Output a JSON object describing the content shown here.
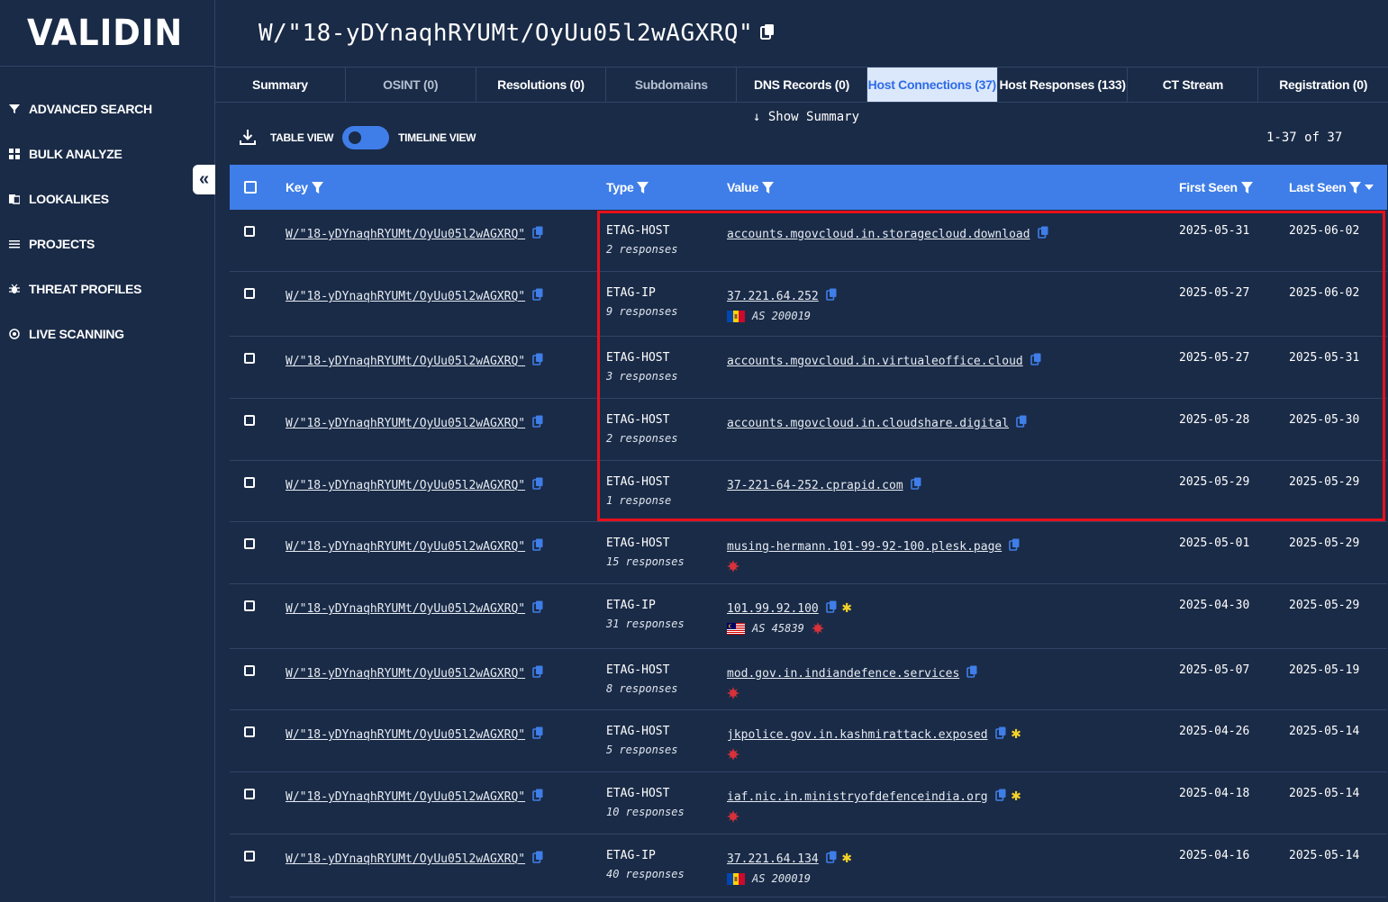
{
  "app": {
    "logo": "VALIDIN"
  },
  "sidebar": {
    "items": [
      {
        "label": "ADVANCED SEARCH",
        "icon": "filter-icon"
      },
      {
        "label": "BULK ANALYZE",
        "icon": "grid-icon"
      },
      {
        "label": "LOOKALIKES",
        "icon": "lookalike-icon"
      },
      {
        "label": "PROJECTS",
        "icon": "list-icon"
      },
      {
        "label": "THREAT PROFILES",
        "icon": "bug-icon"
      },
      {
        "label": "LIVE SCANNING",
        "icon": "target-icon"
      }
    ],
    "collapse_glyph": "«"
  },
  "header": {
    "title": "W/\"18-yDYnaqhRYUMt/OyUu05l2wAGXRQ\""
  },
  "tabs": [
    {
      "label": "Summary",
      "state": "normal"
    },
    {
      "label": "OSINT (0)",
      "state": "disabled"
    },
    {
      "label": "Resolutions (0)",
      "state": "normal"
    },
    {
      "label": "Subdomains",
      "state": "disabled"
    },
    {
      "label": "DNS Records (0)",
      "state": "normal"
    },
    {
      "label": "Host Connections (37)",
      "state": "active"
    },
    {
      "label": "Host Responses (133)",
      "state": "normal"
    },
    {
      "label": "CT Stream",
      "state": "normal"
    },
    {
      "label": "Registration (0)",
      "state": "normal"
    }
  ],
  "toolbar": {
    "show_summary": "Show Summary",
    "table_view": "TABLE VIEW",
    "timeline_view": "TIMELINE VIEW",
    "pagination": "1-37 of 37"
  },
  "table": {
    "columns": {
      "key": "Key",
      "type": "Type",
      "value": "Value",
      "first_seen": "First Seen",
      "last_seen": "Last Seen"
    },
    "rows": [
      {
        "key": "W/\"18-yDYnaqhRYUMt/OyUu05l2wAGXRQ\"",
        "type": "ETAG-HOST",
        "responses": "2 responses",
        "value": "accounts.mgovcloud.in.storagecloud.download",
        "first": "2025-05-31",
        "last": "2025-06-02"
      },
      {
        "key": "W/\"18-yDYnaqhRYUMt/OyUu05l2wAGXRQ\"",
        "type": "ETAG-IP",
        "responses": "9 responses",
        "value": "37.221.64.252",
        "asn": "AS 200019",
        "flag": "md",
        "first": "2025-05-27",
        "last": "2025-06-02"
      },
      {
        "key": "W/\"18-yDYnaqhRYUMt/OyUu05l2wAGXRQ\"",
        "type": "ETAG-HOST",
        "responses": "3 responses",
        "value": "accounts.mgovcloud.in.virtualeoffice.cloud",
        "first": "2025-05-27",
        "last": "2025-05-31"
      },
      {
        "key": "W/\"18-yDYnaqhRYUMt/OyUu05l2wAGXRQ\"",
        "type": "ETAG-HOST",
        "responses": "2 responses",
        "value": "accounts.mgovcloud.in.cloudshare.digital",
        "first": "2025-05-28",
        "last": "2025-05-30"
      },
      {
        "key": "W/\"18-yDYnaqhRYUMt/OyUu05l2wAGXRQ\"",
        "type": "ETAG-HOST",
        "responses": "1 response",
        "value": "37-221-64-252.cprapid.com",
        "first": "2025-05-29",
        "last": "2025-05-29"
      },
      {
        "key": "W/\"18-yDYnaqhRYUMt/OyUu05l2wAGXRQ\"",
        "type": "ETAG-HOST",
        "responses": "15 responses",
        "value": "musing-hermann.101-99-92-100.plesk.page",
        "threat": true,
        "first": "2025-05-01",
        "last": "2025-05-29"
      },
      {
        "key": "W/\"18-yDYnaqhRYUMt/OyUu05l2wAGXRQ\"",
        "type": "ETAG-IP",
        "responses": "31 responses",
        "value": "101.99.92.100",
        "star": true,
        "asn": "AS 45839",
        "flag": "my",
        "asn_threat": true,
        "first": "2025-04-30",
        "last": "2025-05-29"
      },
      {
        "key": "W/\"18-yDYnaqhRYUMt/OyUu05l2wAGXRQ\"",
        "type": "ETAG-HOST",
        "responses": "8 responses",
        "value": "mod.gov.in.indiandefence.services",
        "threat": true,
        "first": "2025-05-07",
        "last": "2025-05-19"
      },
      {
        "key": "W/\"18-yDYnaqhRYUMt/OyUu05l2wAGXRQ\"",
        "type": "ETAG-HOST",
        "responses": "5 responses",
        "value": "jkpolice.gov.in.kashmirattack.exposed",
        "star": true,
        "threat": true,
        "first": "2025-04-26",
        "last": "2025-05-14"
      },
      {
        "key": "W/\"18-yDYnaqhRYUMt/OyUu05l2wAGXRQ\"",
        "type": "ETAG-HOST",
        "responses": "10 responses",
        "value": "iaf.nic.in.ministryofdefenceindia.org",
        "star": true,
        "threat": true,
        "first": "2025-04-18",
        "last": "2025-05-14"
      },
      {
        "key": "W/\"18-yDYnaqhRYUMt/OyUu05l2wAGXRQ\"",
        "type": "ETAG-IP",
        "responses": "40 responses",
        "value": "37.221.64.134",
        "star": true,
        "asn": "AS 200019",
        "flag": "md",
        "first": "2025-04-16",
        "last": "2025-05-14"
      }
    ]
  },
  "colors": {
    "background": "#1a2b47",
    "accent": "#3f7ee8",
    "highlight": "#e8101a",
    "star": "#f4d228",
    "threat": "#d8313a"
  }
}
